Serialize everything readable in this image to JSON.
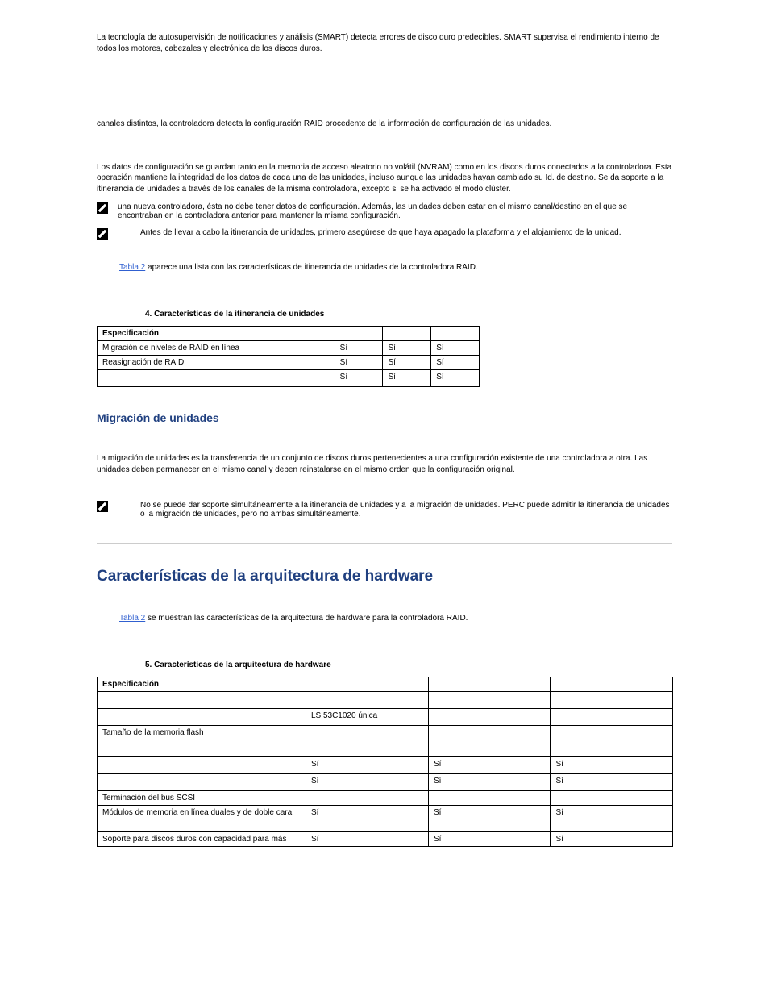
{
  "p1": "La tecnología de autosupervisión de notificaciones y análisis (SMART) detecta errores de disco duro predecibles. SMART supervisa el rendimiento interno de todos los motores, cabezales y electrónica de los discos duros.",
  "p2": "canales distintos, la controladora detecta la configuración RAID procedente de la información de configuración de las unidades.",
  "p3": "Los datos de configuración se guardan tanto en la memoria de acceso aleatorio no volátil (NVRAM) como en los discos duros conectados a la controladora. Esta operación mantiene la integridad de los datos de cada una de las unidades, incluso aunque las unidades hayan cambiado su Id. de destino. Se da soporte a la itinerancia de unidades a través de los canales de la misma controladora, excepto si se ha activado el modo clúster.",
  "note1": "una nueva controladora, ésta no debe tener datos de configuración. Además, las unidades deben estar en el mismo canal/destino en el que se encontraban en la controladora anterior para mantener la misma configuración.",
  "note2": "Antes de llevar a cabo la itinerancia de unidades, primero asegúrese de que haya apagado la plataforma y el alojamiento de la unidad.",
  "link1_label": "Tabla 2",
  "link1_after": " aparece una lista con las características de itinerancia de unidades de la controladora RAID.",
  "table1_caption": "4. Características de la itinerancia de unidades",
  "table1": {
    "header": "Especificación",
    "rows": [
      {
        "spec": "Migración de niveles de RAID en línea",
        "v1": "Sí",
        "v2": "Sí",
        "v3": "Sí"
      },
      {
        "spec": "Reasignación de RAID",
        "v1": "Sí",
        "v2": "Sí",
        "v3": "Sí"
      },
      {
        "spec": "",
        "v1": "Sí",
        "v2": "Sí",
        "v3": "Sí"
      }
    ]
  },
  "h2_1": "Migración de unidades",
  "p4": "La migración de unidades es la transferencia de un conjunto de discos duros pertenecientes a una configuración existente de una controladora a otra. Las unidades deben permanecer en el mismo canal y deben reinstalarse en el mismo orden que la configuración original.",
  "note3": "No se puede dar soporte simultáneamente a la itinerancia de unidades y a la migración de unidades. PERC puede admitir la itinerancia de unidades o la migración de unidades, pero no ambas simultáneamente.",
  "h1_1": "Características de la arquitectura de hardware",
  "link2_label": "Tabla 2",
  "link2_after": " se muestran las características de la arquitectura de hardware para la controladora RAID.",
  "table2_caption": "5. Características de la arquitectura de hardware",
  "table2": {
    "header": "Especificación",
    "rows": [
      {
        "spec": "",
        "v1": "",
        "v2": "",
        "v3": ""
      },
      {
        "spec": "",
        "v1": "LSI53C1020 única",
        "v2": "",
        "v3": ""
      },
      {
        "spec": "Tamaño de la memoria flash",
        "v1": "",
        "v2": "",
        "v3": ""
      },
      {
        "spec": "",
        "v1": "",
        "v2": "",
        "v3": ""
      },
      {
        "spec": "",
        "v1": "Sí",
        "v2": "Sí",
        "v3": "Sí"
      },
      {
        "spec": "",
        "v1": "Sí",
        "v2": "Sí",
        "v3": "Sí"
      },
      {
        "spec": "Terminación del bus SCSI",
        "v1": "",
        "v2": "",
        "v3": ""
      },
      {
        "spec": "Módulos de memoria en línea duales y de doble cara",
        "v1": "Sí",
        "v2": "Sí",
        "v3": "Sí"
      },
      {
        "spec": "Soporte para discos duros con capacidad para más",
        "v1": "Sí",
        "v2": "Sí",
        "v3": "Sí"
      }
    ]
  }
}
